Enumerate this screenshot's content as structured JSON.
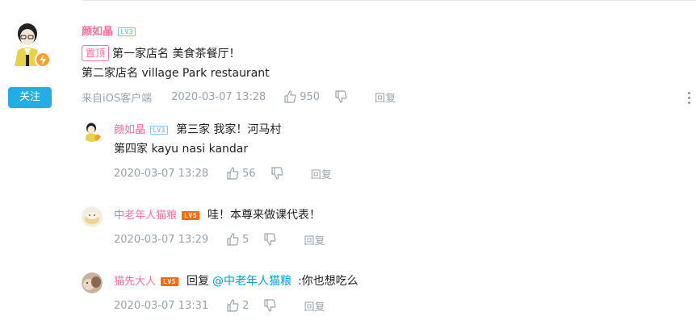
{
  "main_comment": {
    "username": "颜如晶",
    "level": "LV3",
    "pin_label": "置顶",
    "line1": "第一家店名 美食茶餐厅！",
    "line2": "第二家店名 village Park restaurant",
    "source": "来自iOS客户端",
    "time": "2020-03-07 13:28",
    "likes": "950",
    "reply_label": "回复",
    "follow_label": "关注"
  },
  "replies": [
    {
      "username": "颜如晶",
      "level": "LV3",
      "content": "第三家 我家！河马村",
      "content2": "第四家 kayu nasi kandar",
      "time": "2020-03-07 13:28",
      "likes": "56",
      "reply_label": "回复"
    },
    {
      "username": "中老年人猫粮",
      "level": "LV5",
      "content": "哇！本尊来做课代表！",
      "time": "2020-03-07 13:29",
      "likes": "5",
      "reply_label": "回复"
    },
    {
      "username": "猫先大人",
      "level": "LV5",
      "reply_prefix": "回复",
      "mention": "@中老年人猫粮",
      "content": ":你也想吃么",
      "time": "2020-03-07 13:31",
      "likes": "2",
      "reply_label": "回复"
    }
  ],
  "colors": {
    "username": "#fb7299",
    "follow_button": "#23ade5",
    "meta_text": "#99a2aa",
    "mention": "#00a1d6",
    "level5": "#ff6c00"
  }
}
